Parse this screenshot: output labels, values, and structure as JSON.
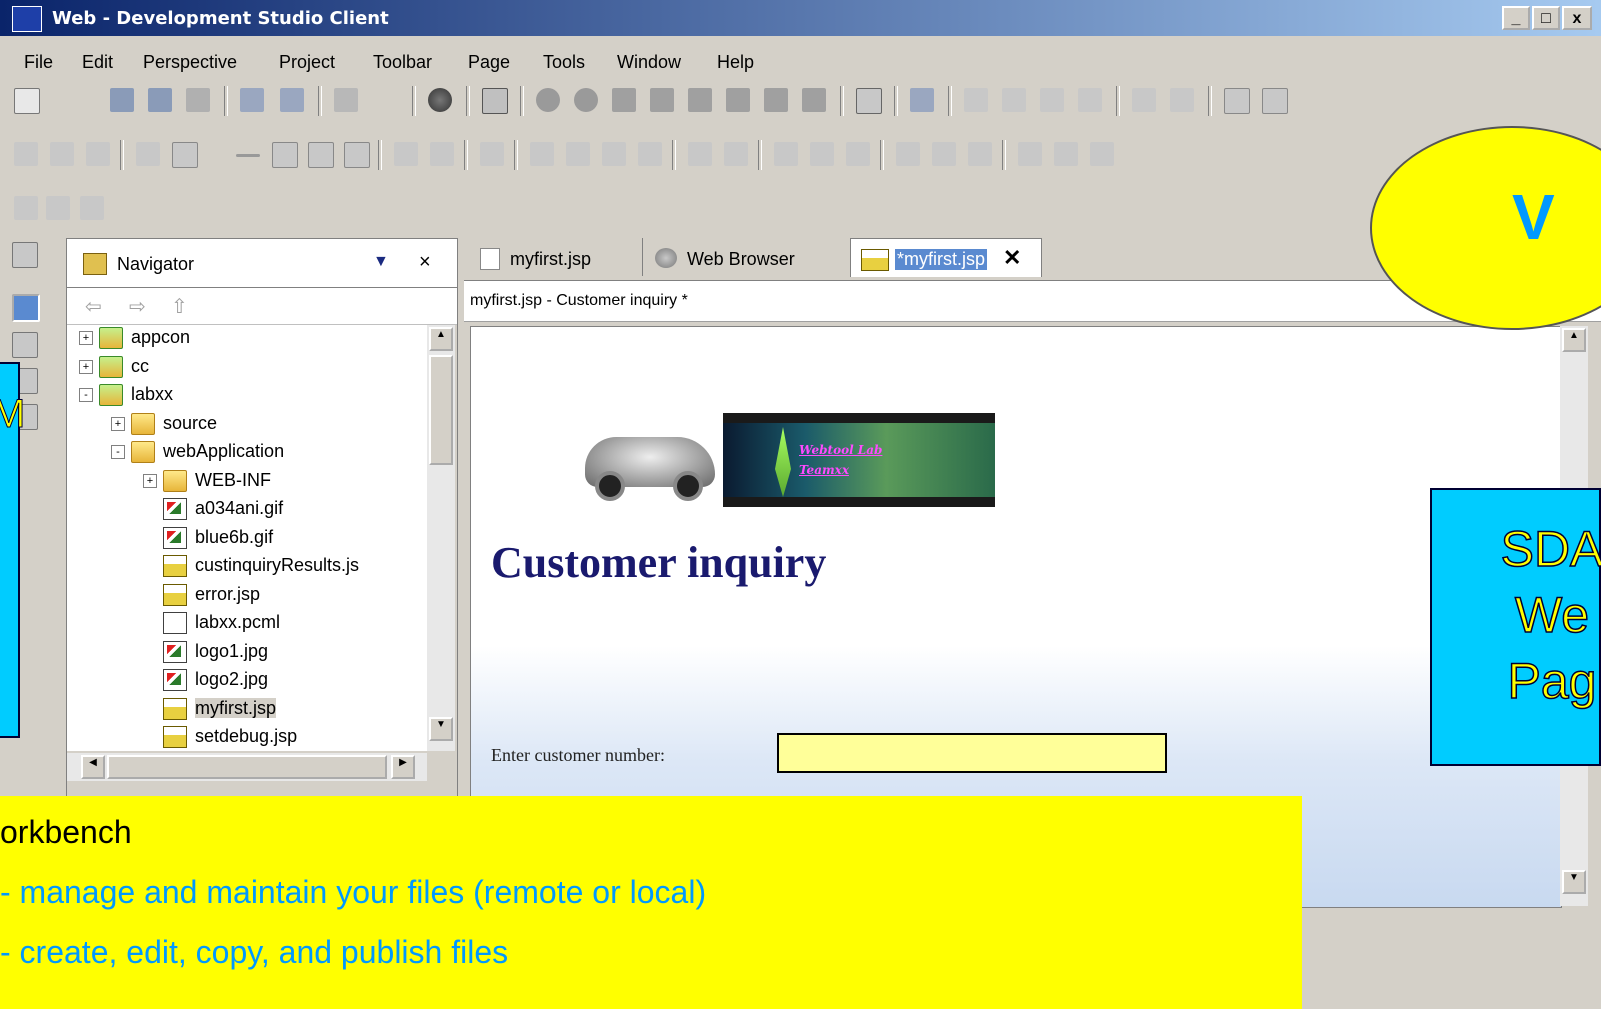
{
  "window": {
    "title": "Web - Development Studio Client",
    "buttons": [
      "_",
      "□",
      "x"
    ]
  },
  "menu": [
    "File",
    "Edit",
    "Perspective",
    "Project",
    "Toolbar",
    "Page",
    "Tools",
    "Window",
    "Help"
  ],
  "navigator": {
    "title": "Navigator",
    "tree": [
      {
        "label": "appcon",
        "indent": 0,
        "icon": "project-folder-icon",
        "expander": "+"
      },
      {
        "label": "cc",
        "indent": 0,
        "icon": "project-folder-icon",
        "expander": "+"
      },
      {
        "label": "labxx",
        "indent": 0,
        "icon": "project-folder-icon",
        "expander": "-"
      },
      {
        "label": "source",
        "indent": 1,
        "icon": "folder-icon",
        "expander": "+"
      },
      {
        "label": "webApplication",
        "indent": 1,
        "icon": "folder-icon",
        "expander": "-"
      },
      {
        "label": "WEB-INF",
        "indent": 2,
        "icon": "folder-icon",
        "expander": "+"
      },
      {
        "label": "a034ani.gif",
        "indent": 2,
        "icon": "image-file-icon",
        "expander": ""
      },
      {
        "label": "blue6b.gif",
        "indent": 2,
        "icon": "image-file-icon",
        "expander": ""
      },
      {
        "label": "custinquiryResults.js",
        "indent": 2,
        "icon": "jsp-file-icon",
        "expander": ""
      },
      {
        "label": "error.jsp",
        "indent": 2,
        "icon": "jsp-file-icon",
        "expander": ""
      },
      {
        "label": "labxx.pcml",
        "indent": 2,
        "icon": "document-icon",
        "expander": ""
      },
      {
        "label": "logo1.jpg",
        "indent": 2,
        "icon": "image-file-icon",
        "expander": ""
      },
      {
        "label": "logo2.jpg",
        "indent": 2,
        "icon": "image-file-icon",
        "expander": ""
      },
      {
        "label": "myfirst.jsp",
        "indent": 2,
        "icon": "jsp-file-icon",
        "expander": "",
        "selected": true
      },
      {
        "label": "setdebug.jsp",
        "indent": 2,
        "icon": "jsp-file-icon",
        "expander": ""
      }
    ]
  },
  "editor": {
    "tabs": [
      {
        "label": "myfirst.jsp",
        "active": false
      },
      {
        "label": "Web Browser",
        "active": false
      },
      {
        "label": "*myfirst.jsp",
        "active": true
      }
    ],
    "path_title": "myfirst.jsp - Customer inquiry *",
    "page": {
      "banner_text_line1": "Webtool Lab",
      "banner_text_line2": "Teamxx",
      "heading": "Customer inquiry",
      "field_label": "Enter customer number:",
      "field_value": ""
    }
  },
  "callouts": {
    "bottom": {
      "line1": "orkbench",
      "line2": "- manage and maintain your  files (remote or local)",
      "line3": "- create, edit, copy, and publish files"
    },
    "right_cyan": [
      "SDA",
      "We",
      "Pag"
    ],
    "left_cyan": "M",
    "top_right_bubble": "V"
  },
  "colors": {
    "callout_yellow": "#ffff00",
    "callout_cyan": "#00ccff",
    "callout_text_blue": "#0099ff",
    "heading_navy": "#1a1a6e"
  }
}
